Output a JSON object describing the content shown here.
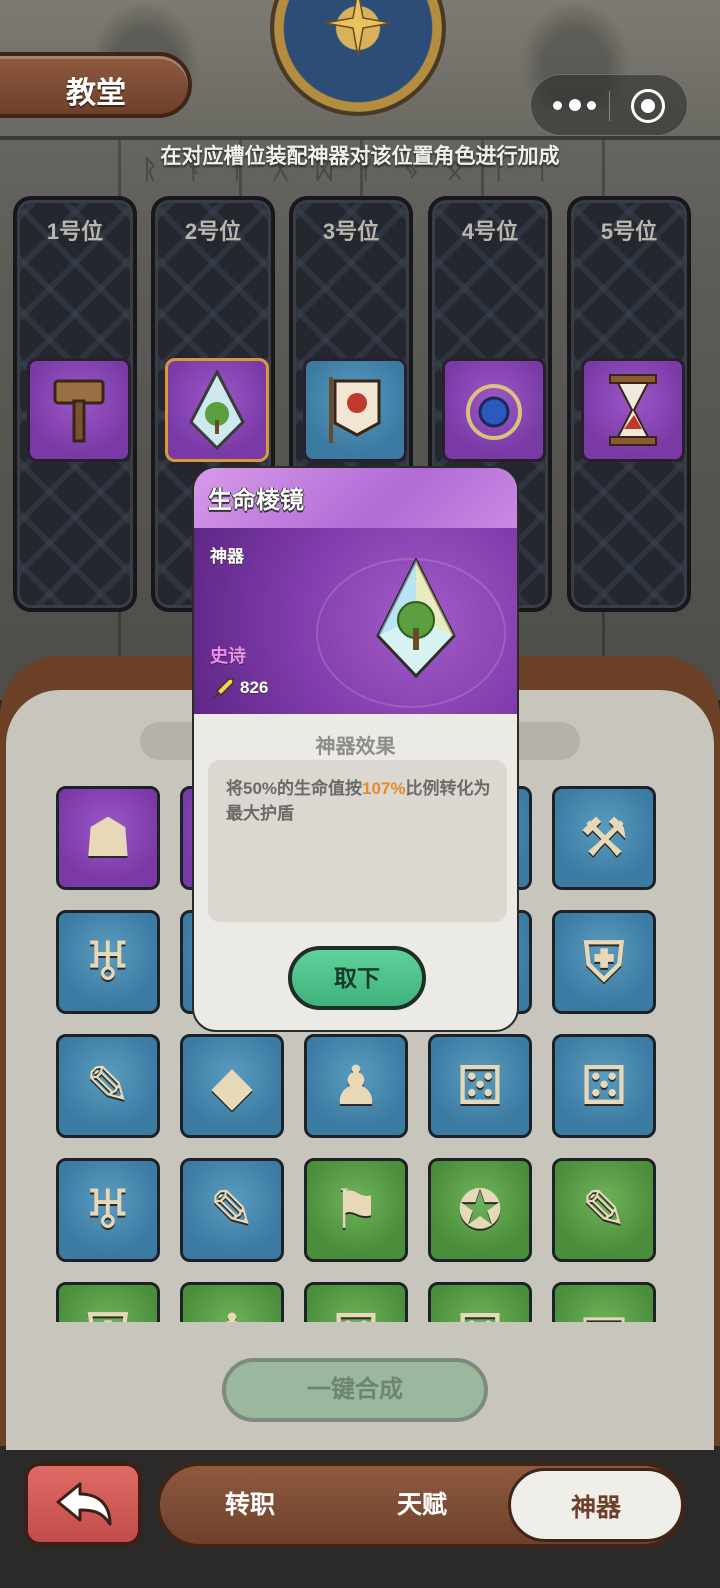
{
  "header": {
    "title": "教堂",
    "subtitle": "在对应槽位装配神器对该位置角色进行加成"
  },
  "capsule": {
    "menu_icon": "more-dots-icon",
    "close_icon": "target-circle-icon"
  },
  "slots": [
    {
      "label": "1号位",
      "item_icon": "hammer-icon",
      "rarity_color": "purple"
    },
    {
      "label": "2号位",
      "item_icon": "prism-icon",
      "rarity_color": "purple"
    },
    {
      "label": "3号位",
      "item_icon": "banner-icon",
      "rarity_color": "blue"
    },
    {
      "label": "4号位",
      "item_icon": "amulet-icon",
      "rarity_color": "purple"
    },
    {
      "label": "5号位",
      "item_icon": "hourglass-icon",
      "rarity_color": "purple"
    }
  ],
  "inventory": [
    {
      "icon": "mask-icon",
      "rarity": "purple"
    },
    {
      "icon": "unknown-icon",
      "rarity": "purple"
    },
    {
      "icon": "unknown-icon",
      "rarity": "blue"
    },
    {
      "icon": "unknown-icon",
      "rarity": "blue"
    },
    {
      "icon": "hammer-icon",
      "rarity": "blue"
    },
    {
      "icon": "chalice-icon",
      "rarity": "blue"
    },
    {
      "icon": "unknown-icon",
      "rarity": "blue"
    },
    {
      "icon": "unknown-icon",
      "rarity": "blue"
    },
    {
      "icon": "unknown-icon",
      "rarity": "blue"
    },
    {
      "icon": "armor-icon",
      "rarity": "blue"
    },
    {
      "icon": "scroll-icon",
      "rarity": "blue"
    },
    {
      "icon": "prism-icon",
      "rarity": "blue"
    },
    {
      "icon": "hooded-figure-icon",
      "rarity": "blue"
    },
    {
      "icon": "dice-icon",
      "rarity": "blue"
    },
    {
      "icon": "dice-icon",
      "rarity": "blue"
    },
    {
      "icon": "chalice-icon",
      "rarity": "blue"
    },
    {
      "icon": "scroll-icon",
      "rarity": "blue"
    },
    {
      "icon": "banner-icon",
      "rarity": "green"
    },
    {
      "icon": "amulet-icon",
      "rarity": "green"
    },
    {
      "icon": "scroll-icon",
      "rarity": "green"
    },
    {
      "icon": "armor-icon",
      "rarity": "green"
    },
    {
      "icon": "hooded-figure-icon",
      "rarity": "green"
    },
    {
      "icon": "dice-icon",
      "rarity": "green"
    },
    {
      "icon": "dice-icon",
      "rarity": "green"
    },
    {
      "icon": "book-icon",
      "rarity": "green"
    }
  ],
  "merge_button": "一键合成",
  "nav": {
    "back_icon": "back-arrow-icon",
    "tabs": [
      {
        "label": "转职"
      },
      {
        "label": "天赋"
      },
      {
        "label": "神器"
      }
    ],
    "active_tab": "神器"
  },
  "popup": {
    "name": "生命棱镜",
    "type": "神器",
    "rarity": "史诗",
    "power": "826",
    "effect_title": "神器效果",
    "effect_text_before": "将50%的生命值按",
    "effect_highlight": "107%",
    "effect_text_after": "比例转化为最大护盾",
    "remove_label": "取下",
    "icon": "prism-icon",
    "power_icon": "sword-icon"
  },
  "colors": {
    "purple": "#7a3aa6",
    "blue": "#3b7aa1",
    "green": "#4a8d3a",
    "highlight": "#e58a28",
    "rarity_epic": "#ef8cf2",
    "button_green": "#3fb37c"
  }
}
